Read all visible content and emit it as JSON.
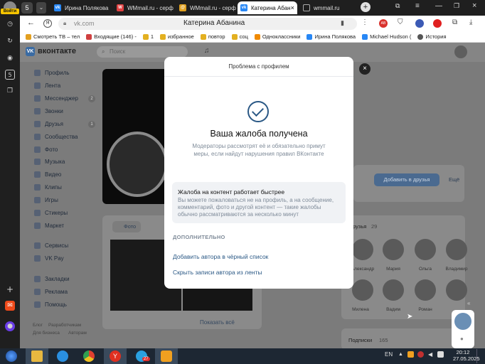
{
  "left_rail": {
    "login_label": "Войти"
  },
  "tabs": [
    {
      "label": "Ирина Полякова",
      "icon": "vk-icon",
      "color": "#2787f5"
    },
    {
      "label": "WMmail.ru - серф",
      "icon": "wmmail-icon",
      "color": "#e04040"
    },
    {
      "label": "WMmail.ru - серф",
      "icon": "wmmail-icon",
      "color": "#e0a020"
    },
    {
      "label": "Катерина Абан",
      "icon": "vk-icon",
      "color": "#2787f5",
      "active": true
    },
    {
      "label": "wmmail.ru",
      "icon": "page-icon",
      "color": "#aaaaaa"
    }
  ],
  "addressbar": {
    "host": "vk.com",
    "title": "Катерина Абанина"
  },
  "bookmarks": [
    {
      "label": "Смотреть ТВ – тел",
      "color": "#e3a020"
    },
    {
      "label": "Входящие (146) - ",
      "color": "#d04040"
    },
    {
      "label": "избранное",
      "color": "#e3b020"
    },
    {
      "label": "1",
      "color": "#e3b020"
    },
    {
      "label": "повтор",
      "color": "#e3b020"
    },
    {
      "label": "соц",
      "color": "#e3b020"
    },
    {
      "label": "Одноклассники",
      "color": "#f08a00"
    },
    {
      "label": "Ирина Полякова",
      "color": "#2787f5"
    },
    {
      "label": "Michael Hudson (",
      "color": "#2787f5"
    },
    {
      "label": "История",
      "color": "#555555"
    }
  ],
  "vk": {
    "logo_text": "вконтакте",
    "search_placeholder": "Поиск",
    "menu": [
      {
        "label": "Профиль"
      },
      {
        "label": "Лента"
      },
      {
        "label": "Мессенджер",
        "badge": "2"
      },
      {
        "label": "Звонки"
      },
      {
        "label": "Друзья",
        "badge": "1"
      },
      {
        "label": "Сообщества"
      },
      {
        "label": "Фото"
      },
      {
        "label": "Музыка"
      },
      {
        "label": "Видео"
      },
      {
        "label": "Клипы"
      },
      {
        "label": "Игры"
      },
      {
        "label": "Стикеры"
      },
      {
        "label": "Маркет"
      },
      {
        "label": "Сервисы"
      },
      {
        "label": "VK Pay"
      },
      {
        "label": "Закладки"
      },
      {
        "label": "Реклама"
      },
      {
        "label": "Помощь"
      }
    ],
    "footer": [
      "Блог",
      "Разработчикам",
      "Для бизнеса",
      "Авторам"
    ],
    "add_friend": "Добавить в друзья",
    "more": "Ещё",
    "friends_label": "Друзья",
    "friends_count": "29",
    "friends": [
      "Александр",
      "Мария",
      "Ольга",
      "Владимир",
      "Милена",
      "Вадим",
      "Роман",
      ""
    ],
    "photo_tab": "Фото",
    "show_all": "Показать всё",
    "subscriptions_label": "Подписки",
    "subscriptions_count": "165"
  },
  "modal": {
    "title": "Проблема с профилем",
    "heading": "Ваша жалоба получена",
    "description": "Модераторы рассмотрят её и обязательно примут меры, если найдут нарушения правил ВКонтакте",
    "info_title": "Жалоба на контент работает быстрее",
    "info_text": "Вы можете пожаловаться не на профиль, а на сообщение, комментарий, фото и другой контент — такие жалобы обычно рассматриваются за несколько минут",
    "section": "ДОПОЛНИТЕЛЬНО",
    "link_blacklist": "Добавить автора в чёрный список",
    "link_hide": "Скрыть записи автора из ленты",
    "close": "×"
  },
  "taskbar": {
    "lang": "EN",
    "time": "20:12",
    "date": "27.05.2025",
    "telegram_badge": "27"
  }
}
